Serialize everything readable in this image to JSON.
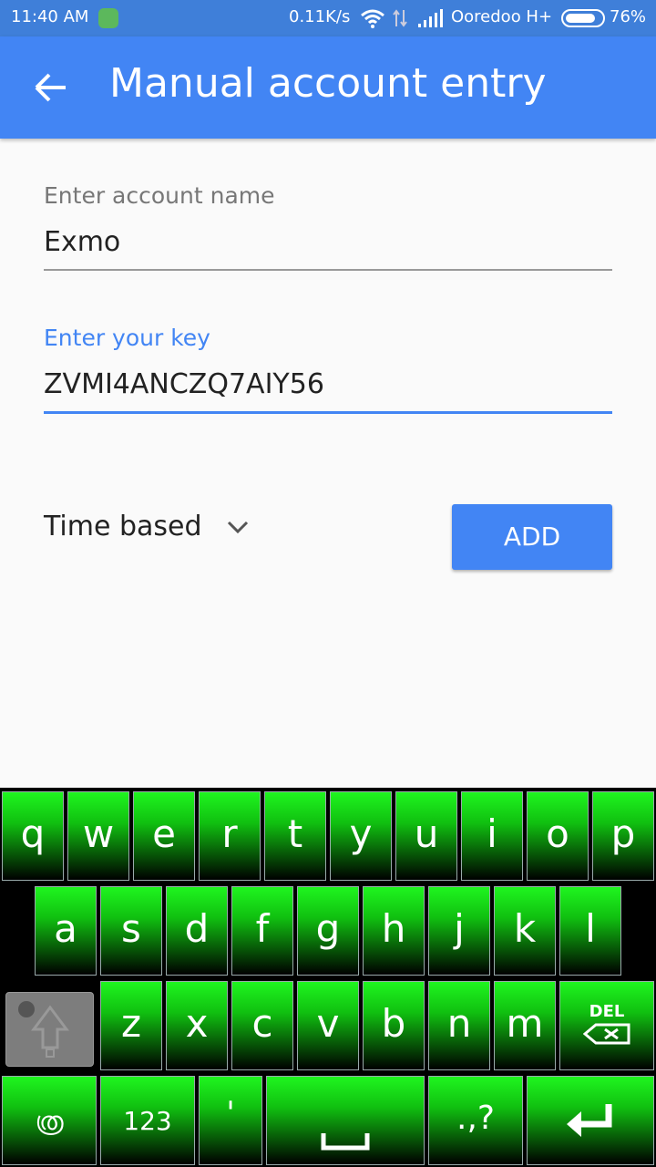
{
  "status_bar": {
    "time": "11:40 AM",
    "notification_icon": "android-notification-icon",
    "net_speed": "0.11K/s",
    "carrier": "Ooredoo H+",
    "battery_percent": "76%",
    "battery_level": 0.76
  },
  "app_bar": {
    "title": "Manual account entry",
    "back_icon": "arrow-back-icon",
    "color": "#4285f4"
  },
  "form": {
    "account_name": {
      "label": "Enter account name",
      "value": "Exmo"
    },
    "key": {
      "label": "Enter your key",
      "value": "ZVMI4ANCZQ7AIY56",
      "focused": true
    },
    "type_select": {
      "selected": "Time based",
      "icon": "chevron-down-icon"
    },
    "add_button": "ADD"
  },
  "keyboard": {
    "row1": [
      "q",
      "w",
      "e",
      "r",
      "t",
      "y",
      "u",
      "i",
      "o",
      "p"
    ],
    "row2": [
      "a",
      "s",
      "d",
      "f",
      "g",
      "h",
      "j",
      "k",
      "l"
    ],
    "row3": [
      "z",
      "x",
      "c",
      "v",
      "b",
      "n",
      "m"
    ],
    "del_label": "DEL",
    "row4": {
      "lang": "ത്ര",
      "numbers": "123",
      "apostrophe": "'",
      "punct": ".,?"
    },
    "key_color": "#1ff51f"
  }
}
